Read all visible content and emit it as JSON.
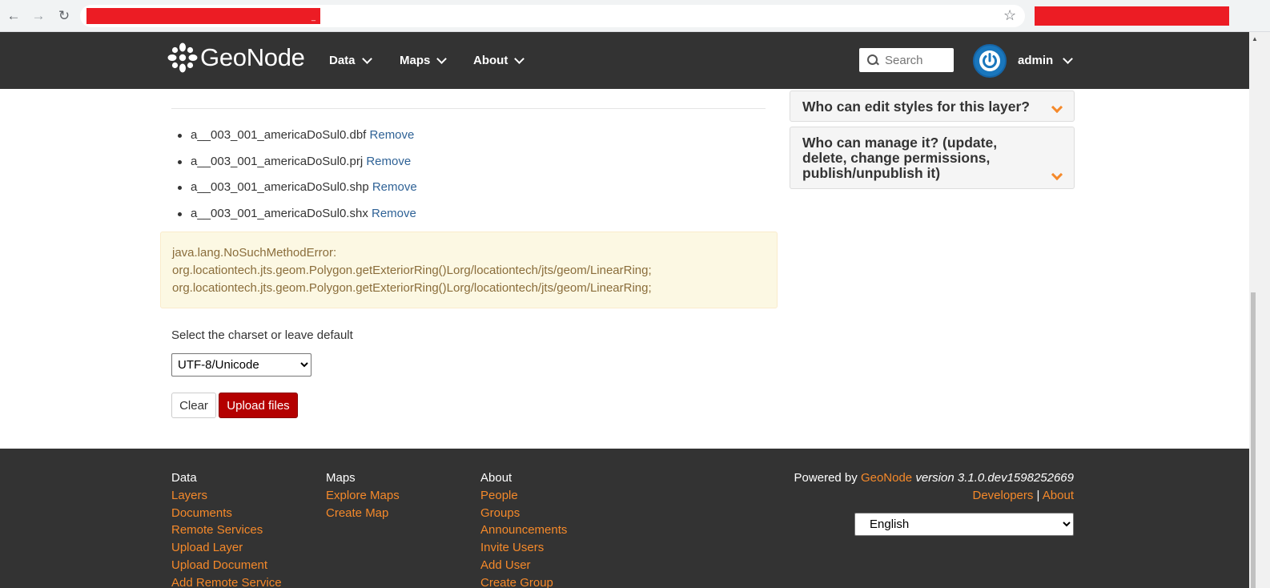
{
  "browser": {
    "back_icon": "arrow-left-icon",
    "forward_icon": "arrow-right-icon",
    "reload_icon": "reload-icon",
    "star_icon": "star-outline-icon"
  },
  "navbar": {
    "brand": "GeoNode",
    "items": [
      {
        "label": "Data"
      },
      {
        "label": "Maps"
      },
      {
        "label": "About"
      }
    ],
    "search_placeholder": "Search",
    "user": "admin"
  },
  "upload": {
    "files": [
      {
        "name": "a__003_001_americaDoSul0.dbf",
        "action": "Remove"
      },
      {
        "name": "a__003_001_americaDoSul0.prj",
        "action": "Remove"
      },
      {
        "name": "a__003_001_americaDoSul0.shp",
        "action": "Remove"
      },
      {
        "name": "a__003_001_americaDoSul0.shx",
        "action": "Remove"
      }
    ],
    "error_lines": [
      "java.lang.NoSuchMethodError:",
      "org.locationtech.jts.geom.Polygon.getExteriorRing()Lorg/locationtech/jts/geom/LinearRing;",
      "org.locationtech.jts.geom.Polygon.getExteriorRing()Lorg/locationtech/jts/geom/LinearRing;"
    ],
    "charset_label": "Select the charset or leave default",
    "charset_value": "UTF-8/Unicode",
    "clear_label": "Clear",
    "upload_label": "Upload files"
  },
  "permissions": {
    "panels": [
      {
        "title": "Who can edit styles for this layer?"
      },
      {
        "title": "Who can manage it? (update, delete, change permissions, publish/unpublish it)"
      }
    ]
  },
  "footer": {
    "columns": [
      {
        "heading": "Data",
        "links": [
          "Layers",
          "Documents",
          "Remote Services",
          "Upload Layer",
          "Upload Document",
          "Add Remote Service"
        ]
      },
      {
        "heading": "Maps",
        "links": [
          "Explore Maps",
          "Create Map"
        ]
      },
      {
        "heading": "About",
        "links": [
          "People",
          "Groups",
          "Announcements",
          "Invite Users",
          "Add User",
          "Create Group"
        ]
      }
    ],
    "powered_by": "Powered by",
    "powered_brand": "GeoNode",
    "version": "version 3.1.0.dev1598252669",
    "developers_label": "Developers",
    "separator": "|",
    "about_label": "About",
    "language": "English"
  },
  "colors": {
    "navbar_bg": "#333333",
    "link_orange": "#f5892a",
    "upload_button": "#b40000",
    "remove_link": "#2f6296",
    "alert_bg": "#fcf8e3",
    "redaction": "#ec1c24"
  }
}
